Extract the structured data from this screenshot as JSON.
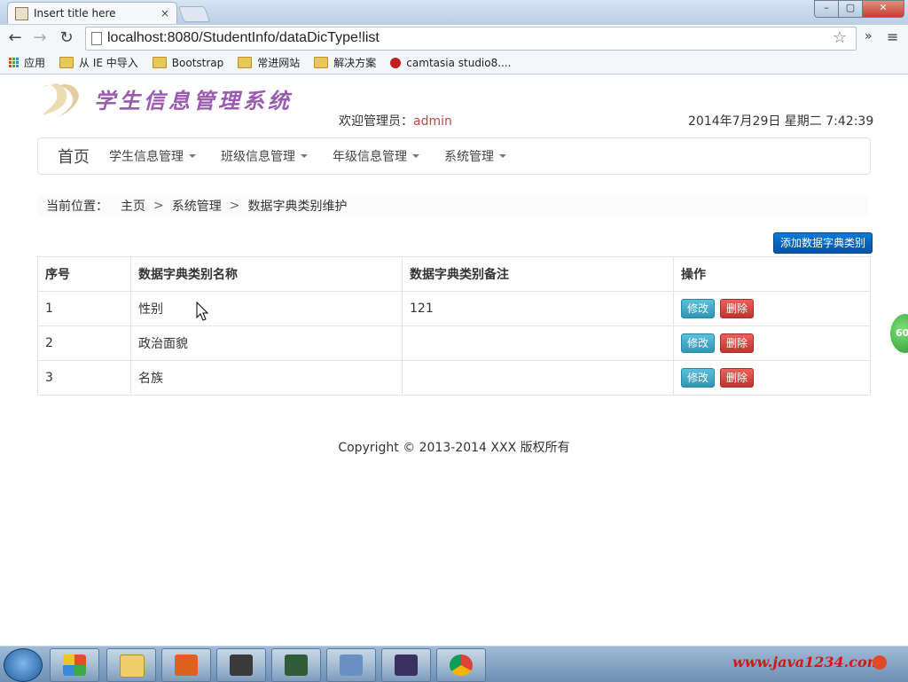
{
  "browser": {
    "tab_title": "Insert title here",
    "tab_close": "×",
    "url": "localhost:8080/StudentInfo/dataDicType!list",
    "bookmarks": [
      {
        "label": "应用",
        "icon": "apps-icon"
      },
      {
        "label": "从 IE 中导入",
        "icon": "folder-icon"
      },
      {
        "label": "Bootstrap",
        "icon": "folder-icon"
      },
      {
        "label": "常进网站",
        "icon": "folder-icon"
      },
      {
        "label": "解决方案",
        "icon": "folder-icon"
      },
      {
        "label": "camtasia studio8....",
        "icon": "camtasia-icon"
      }
    ]
  },
  "header": {
    "logo_text": "学生信息管理系统",
    "welcome_prefix": "欢迎管理员：",
    "admin_name": "admin",
    "datetime": "2014年7月29日 星期二 7:42:39"
  },
  "nav": {
    "home": "首页",
    "items": [
      "学生信息管理",
      "班级信息管理",
      "年级信息管理",
      "系统管理"
    ]
  },
  "breadcrumb": {
    "label": "当前位置：",
    "home": "主页",
    "sep": ">",
    "section": "系统管理",
    "current": "数据字典类别维护"
  },
  "actions": {
    "add_label": "添加数据字典类别"
  },
  "table": {
    "headers": [
      "序号",
      "数据字典类别名称",
      "数据字典类别备注",
      "操作"
    ],
    "rows": [
      {
        "no": "1",
        "name": "性别",
        "remark": "121"
      },
      {
        "no": "2",
        "name": "政治面貌",
        "remark": ""
      },
      {
        "no": "3",
        "name": "名族",
        "remark": ""
      }
    ],
    "edit_label": "修改",
    "delete_label": "删除"
  },
  "footer": {
    "copyright": "Copyright © 2013-2014 XXX 版权所有"
  },
  "badge": {
    "text": "60"
  },
  "taskbar": {
    "watermark": "www.java1234.com"
  }
}
